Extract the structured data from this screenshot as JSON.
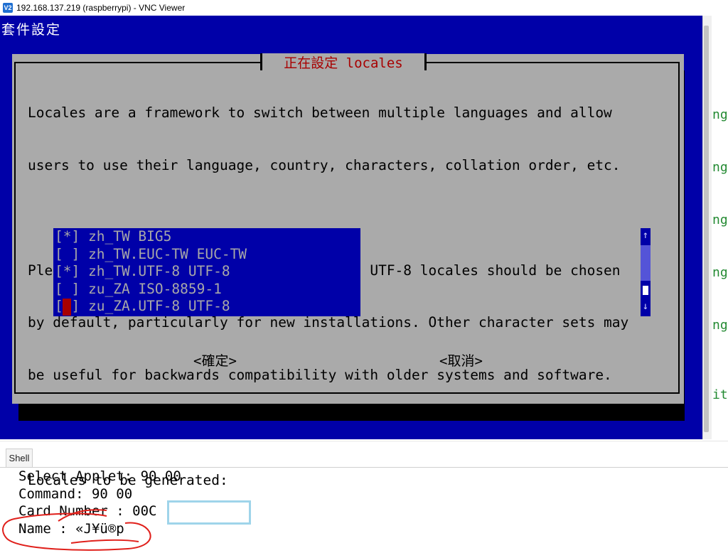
{
  "window": {
    "logo": "V2",
    "title": "192.168.137.219 (raspberrypi) - VNC Viewer"
  },
  "remote": {
    "background_title": "套件設定",
    "right_fragments": [
      "ng",
      "ng",
      "ng",
      "ng",
      "ng",
      "ite"
    ]
  },
  "dialog": {
    "title": "正在設定 locales",
    "description_lines": [
      "Locales are a framework to switch between multiple languages and allow",
      "users to use their language, country, characters, collation order, etc.",
      "",
      "Please choose which locales to generate. UTF-8 locales should be chosen",
      "by default, particularly for new installations. Other character sets may",
      "be useful for backwards compatibility with older systems and software.",
      "",
      "Locales to be generated:"
    ],
    "locales": [
      {
        "mark": "[*]",
        "name": "zh_TW BIG5"
      },
      {
        "mark": "[ ]",
        "name": "zh_TW.EUC-TW EUC-TW"
      },
      {
        "mark": "[*]",
        "name": "zh_TW.UTF-8 UTF-8"
      },
      {
        "mark": "[ ]",
        "name": "zu_ZA ISO-8859-1"
      },
      {
        "mark": "[ ]",
        "name": "zu_ZA.UTF-8 UTF-8"
      }
    ],
    "scroll_up": "↑",
    "scroll_down": "↓",
    "ok_label": "<確定>",
    "cancel_label": "<取消>"
  },
  "shell": {
    "tab_label": "Shell",
    "lines": [
      "Select Applet: 90 00",
      "Command: 90 00",
      "Card Number : 00C",
      "Name : «J¥ü®p"
    ]
  },
  "colors": {
    "debconf_blue": "#0000a8",
    "dialog_gray": "#aaaaaa",
    "title_red": "#a80000",
    "annotation_red": "#e0201b",
    "redact_box": "#9fd4ea"
  }
}
